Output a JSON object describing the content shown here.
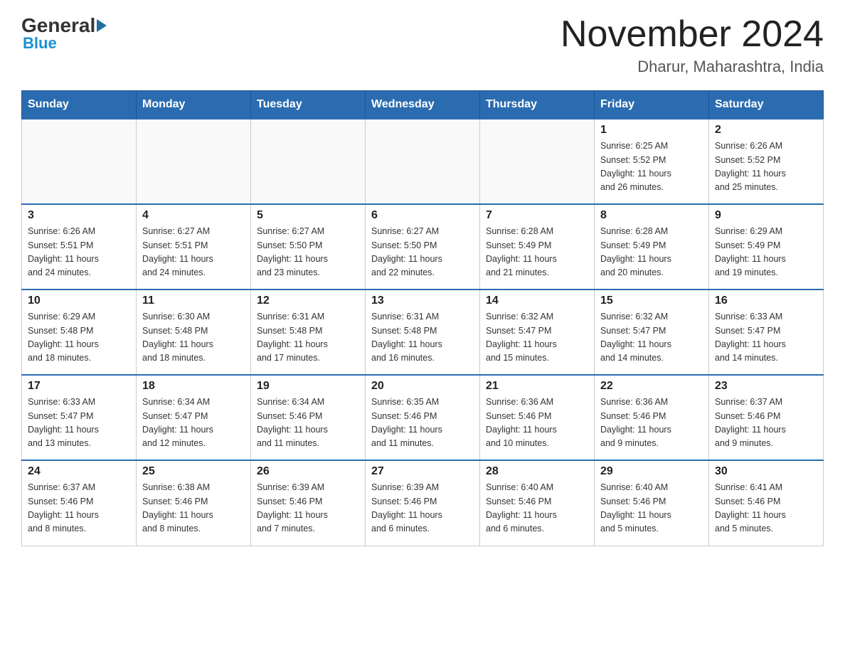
{
  "header": {
    "logo_general": "General",
    "logo_blue": "Blue",
    "month_year": "November 2024",
    "location": "Dharur, Maharashtra, India"
  },
  "weekdays": [
    "Sunday",
    "Monday",
    "Tuesday",
    "Wednesday",
    "Thursday",
    "Friday",
    "Saturday"
  ],
  "weeks": [
    [
      {
        "day": "",
        "info": ""
      },
      {
        "day": "",
        "info": ""
      },
      {
        "day": "",
        "info": ""
      },
      {
        "day": "",
        "info": ""
      },
      {
        "day": "",
        "info": ""
      },
      {
        "day": "1",
        "info": "Sunrise: 6:25 AM\nSunset: 5:52 PM\nDaylight: 11 hours\nand 26 minutes."
      },
      {
        "day": "2",
        "info": "Sunrise: 6:26 AM\nSunset: 5:52 PM\nDaylight: 11 hours\nand 25 minutes."
      }
    ],
    [
      {
        "day": "3",
        "info": "Sunrise: 6:26 AM\nSunset: 5:51 PM\nDaylight: 11 hours\nand 24 minutes."
      },
      {
        "day": "4",
        "info": "Sunrise: 6:27 AM\nSunset: 5:51 PM\nDaylight: 11 hours\nand 24 minutes."
      },
      {
        "day": "5",
        "info": "Sunrise: 6:27 AM\nSunset: 5:50 PM\nDaylight: 11 hours\nand 23 minutes."
      },
      {
        "day": "6",
        "info": "Sunrise: 6:27 AM\nSunset: 5:50 PM\nDaylight: 11 hours\nand 22 minutes."
      },
      {
        "day": "7",
        "info": "Sunrise: 6:28 AM\nSunset: 5:49 PM\nDaylight: 11 hours\nand 21 minutes."
      },
      {
        "day": "8",
        "info": "Sunrise: 6:28 AM\nSunset: 5:49 PM\nDaylight: 11 hours\nand 20 minutes."
      },
      {
        "day": "9",
        "info": "Sunrise: 6:29 AM\nSunset: 5:49 PM\nDaylight: 11 hours\nand 19 minutes."
      }
    ],
    [
      {
        "day": "10",
        "info": "Sunrise: 6:29 AM\nSunset: 5:48 PM\nDaylight: 11 hours\nand 18 minutes."
      },
      {
        "day": "11",
        "info": "Sunrise: 6:30 AM\nSunset: 5:48 PM\nDaylight: 11 hours\nand 18 minutes."
      },
      {
        "day": "12",
        "info": "Sunrise: 6:31 AM\nSunset: 5:48 PM\nDaylight: 11 hours\nand 17 minutes."
      },
      {
        "day": "13",
        "info": "Sunrise: 6:31 AM\nSunset: 5:48 PM\nDaylight: 11 hours\nand 16 minutes."
      },
      {
        "day": "14",
        "info": "Sunrise: 6:32 AM\nSunset: 5:47 PM\nDaylight: 11 hours\nand 15 minutes."
      },
      {
        "day": "15",
        "info": "Sunrise: 6:32 AM\nSunset: 5:47 PM\nDaylight: 11 hours\nand 14 minutes."
      },
      {
        "day": "16",
        "info": "Sunrise: 6:33 AM\nSunset: 5:47 PM\nDaylight: 11 hours\nand 14 minutes."
      }
    ],
    [
      {
        "day": "17",
        "info": "Sunrise: 6:33 AM\nSunset: 5:47 PM\nDaylight: 11 hours\nand 13 minutes."
      },
      {
        "day": "18",
        "info": "Sunrise: 6:34 AM\nSunset: 5:47 PM\nDaylight: 11 hours\nand 12 minutes."
      },
      {
        "day": "19",
        "info": "Sunrise: 6:34 AM\nSunset: 5:46 PM\nDaylight: 11 hours\nand 11 minutes."
      },
      {
        "day": "20",
        "info": "Sunrise: 6:35 AM\nSunset: 5:46 PM\nDaylight: 11 hours\nand 11 minutes."
      },
      {
        "day": "21",
        "info": "Sunrise: 6:36 AM\nSunset: 5:46 PM\nDaylight: 11 hours\nand 10 minutes."
      },
      {
        "day": "22",
        "info": "Sunrise: 6:36 AM\nSunset: 5:46 PM\nDaylight: 11 hours\nand 9 minutes."
      },
      {
        "day": "23",
        "info": "Sunrise: 6:37 AM\nSunset: 5:46 PM\nDaylight: 11 hours\nand 9 minutes."
      }
    ],
    [
      {
        "day": "24",
        "info": "Sunrise: 6:37 AM\nSunset: 5:46 PM\nDaylight: 11 hours\nand 8 minutes."
      },
      {
        "day": "25",
        "info": "Sunrise: 6:38 AM\nSunset: 5:46 PM\nDaylight: 11 hours\nand 8 minutes."
      },
      {
        "day": "26",
        "info": "Sunrise: 6:39 AM\nSunset: 5:46 PM\nDaylight: 11 hours\nand 7 minutes."
      },
      {
        "day": "27",
        "info": "Sunrise: 6:39 AM\nSunset: 5:46 PM\nDaylight: 11 hours\nand 6 minutes."
      },
      {
        "day": "28",
        "info": "Sunrise: 6:40 AM\nSunset: 5:46 PM\nDaylight: 11 hours\nand 6 minutes."
      },
      {
        "day": "29",
        "info": "Sunrise: 6:40 AM\nSunset: 5:46 PM\nDaylight: 11 hours\nand 5 minutes."
      },
      {
        "day": "30",
        "info": "Sunrise: 6:41 AM\nSunset: 5:46 PM\nDaylight: 11 hours\nand 5 minutes."
      }
    ]
  ]
}
